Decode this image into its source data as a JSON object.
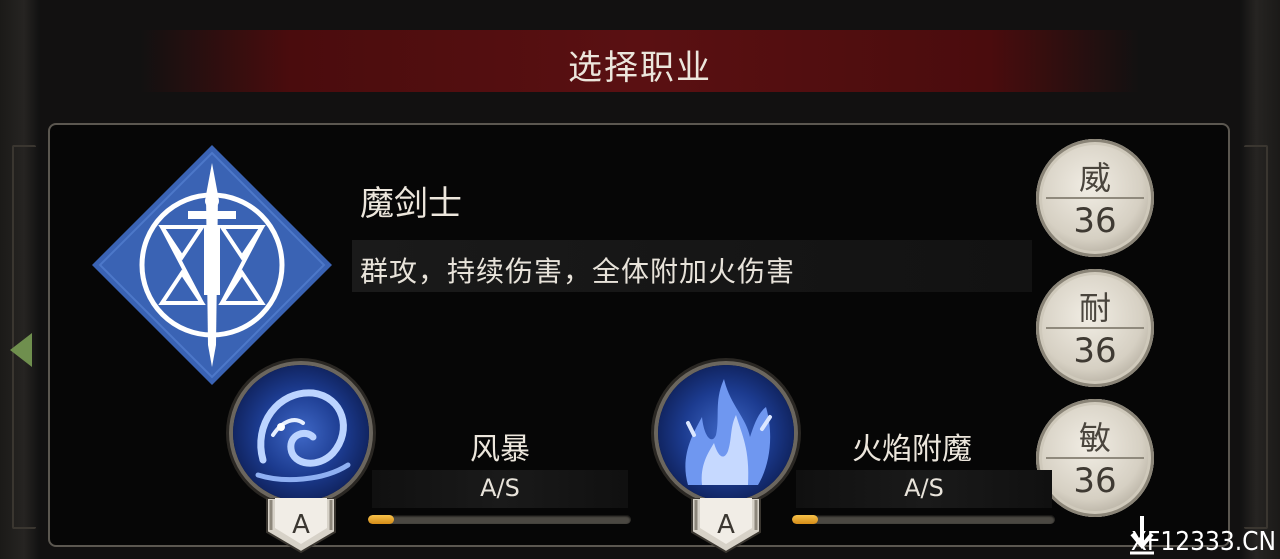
{
  "header": {
    "title": "选择职业"
  },
  "class_card": {
    "icon": "sword-circle-emblem-icon",
    "name": "魔剑士",
    "description": "群攻，持续伤害，全体附加火伤害"
  },
  "stats": [
    {
      "label": "威",
      "value": "36"
    },
    {
      "label": "耐",
      "value": "36"
    },
    {
      "label": "敏",
      "value": "36"
    }
  ],
  "skills": [
    {
      "name": "风暴",
      "rank_text": "A/S",
      "grade": "A",
      "icon": "blue-dragon-icon",
      "progress": 0.1
    },
    {
      "name": "火焰附魔",
      "rank_text": "A/S",
      "grade": "A",
      "icon": "blue-flame-icon",
      "progress": 0.1
    }
  ],
  "navigation": {
    "prev_icon": "left-arrow-icon"
  },
  "colors": {
    "title_bar": "#5a1012",
    "emblem_blue": "#3a63b4",
    "progress_fill": "#e8a22c",
    "stat_coin": "#d6d0c3"
  },
  "watermark": {
    "text": "XF12333.CN"
  }
}
